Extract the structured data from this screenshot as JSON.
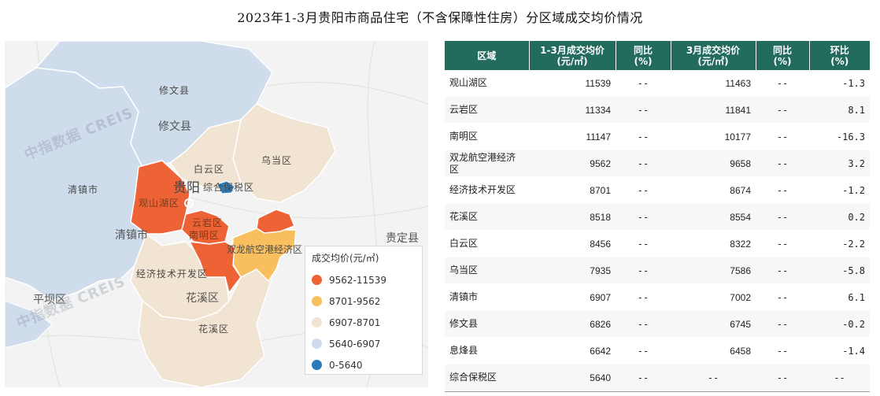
{
  "title": "2023年1-3月贵阳市商品住宅（不含保障性住房）分区域成交均价情况",
  "map": {
    "labels": {
      "xiuwen_small": "修文县",
      "xiuwen_big": "修文县",
      "wudang": "乌当区",
      "baiyun": "白云区",
      "zonghe": "综合保税区",
      "guiyang": "贵阳",
      "qingzhen_small": "清镇市",
      "guanshanhu": "观山湖区",
      "qingzhen_big": "清镇市",
      "nanming": "南明区",
      "yunyan": "云岩区",
      "shuanglong": "双龙航空港经济区",
      "guiding": "贵定县",
      "jingji": "经济技术开发区",
      "huaxi_big": "花溪区",
      "pingba": "平坝区",
      "huaxi_small": "花溪区"
    },
    "watermark": "中指数据 CREIS",
    "colors": {
      "high": "#ee6336",
      "mid_high": "#f8bf5f",
      "mid": "#f1e4d2",
      "low": "#cfdcec",
      "lowest": "#2b7bba"
    }
  },
  "legend": {
    "title": "成交均价(元/㎡)",
    "items": [
      {
        "label": "9562-11539",
        "color": "#ee6336"
      },
      {
        "label": "8701-9562",
        "color": "#f8bf5f"
      },
      {
        "label": "6907-8701",
        "color": "#f1e4d2"
      },
      {
        "label": "5640-6907",
        "color": "#cfdcec"
      },
      {
        "label": "0-5640",
        "color": "#2b7bba"
      }
    ]
  },
  "table": {
    "header_color": "#236b5d",
    "headers": [
      "区域",
      "1-3月成交均价\n(元/㎡)",
      "同比\n(%)",
      "3月成交均价\n(元/㎡)",
      "同比\n(%)",
      "环比\n(%)"
    ],
    "rows": [
      [
        "观山湖区",
        "11539",
        "--",
        "11463",
        "--",
        "-1.3"
      ],
      [
        "云岩区",
        "11334",
        "--",
        "11841",
        "--",
        "8.1"
      ],
      [
        "南明区",
        "11147",
        "--",
        "10177",
        "--",
        "-16.3"
      ],
      [
        "双龙航空港经济区",
        "9562",
        "--",
        "9658",
        "--",
        "3.2"
      ],
      [
        "经济技术开发区",
        "8701",
        "--",
        "8674",
        "--",
        "-1.2"
      ],
      [
        "花溪区",
        "8518",
        "--",
        "8554",
        "--",
        "0.2"
      ],
      [
        "白云区",
        "8456",
        "--",
        "8322",
        "--",
        "-2.2"
      ],
      [
        "乌当区",
        "7935",
        "--",
        "7586",
        "--",
        "-5.8"
      ],
      [
        "清镇市",
        "6907",
        "--",
        "7002",
        "--",
        "6.1"
      ],
      [
        "修文县",
        "6826",
        "--",
        "6745",
        "--",
        "-0.2"
      ],
      [
        "息烽县",
        "6642",
        "--",
        "6458",
        "--",
        "-1.4"
      ],
      [
        "综合保税区",
        "5640",
        "--",
        "--",
        "--",
        "--"
      ]
    ]
  },
  "chart_data": {
    "type": "table",
    "title": "2023年1-3月贵阳市商品住宅（不含保障性住房）分区域成交均价情况",
    "columns": [
      "区域",
      "1-3月成交均价(元/㎡)",
      "同比(%)",
      "3月成交均价(元/㎡)",
      "同比(%)",
      "环比(%)"
    ],
    "categories": [
      "观山湖区",
      "云岩区",
      "南明区",
      "双龙航空港经济区",
      "经济技术开发区",
      "花溪区",
      "白云区",
      "乌当区",
      "清镇市",
      "修文县",
      "息烽县",
      "综合保税区"
    ],
    "series": [
      {
        "name": "1-3月成交均价(元/㎡)",
        "values": [
          11539,
          11334,
          11147,
          9562,
          8701,
          8518,
          8456,
          7935,
          6907,
          6826,
          6642,
          5640
        ]
      },
      {
        "name": "3月成交均价(元/㎡)",
        "values": [
          11463,
          11841,
          10177,
          9658,
          8674,
          8554,
          8322,
          7586,
          7002,
          6745,
          6458,
          null
        ]
      },
      {
        "name": "环比(%)",
        "values": [
          -1.3,
          8.1,
          -16.3,
          3.2,
          -1.2,
          0.2,
          -2.2,
          -5.8,
          6.1,
          -0.2,
          -1.4,
          null
        ]
      }
    ],
    "map_legend_bins": [
      "9562-11539",
      "8701-9562",
      "6907-8701",
      "5640-6907",
      "0-5640"
    ]
  }
}
